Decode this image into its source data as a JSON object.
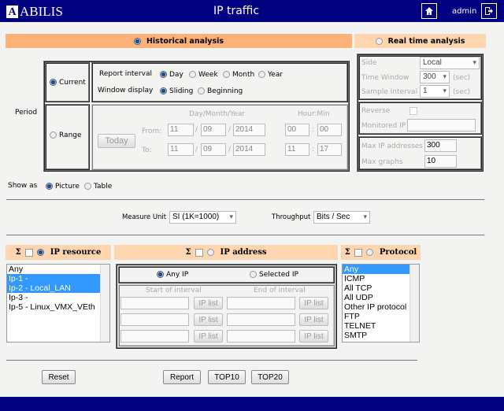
{
  "header": {
    "logo": "ABILIS",
    "title": "IP traffic",
    "user": "admin"
  },
  "tabs": {
    "historical": "Historical analysis",
    "realtime": "Real time analysis"
  },
  "period": {
    "label": "Period",
    "current": "Current",
    "range": "Range",
    "report_interval": "Report interval",
    "intervals": [
      "Day",
      "Week",
      "Month",
      "Year"
    ],
    "window_display": "Window display",
    "windows": [
      "Sliding",
      "Beginning"
    ],
    "dmy": "Day/Month/Year",
    "hm": "Hour:Min",
    "today": "Today",
    "from": "From:",
    "to": "To:",
    "from_vals": [
      "11",
      "09",
      "2014",
      "00",
      "00"
    ],
    "to_vals": [
      "11",
      "09",
      "2014",
      "11",
      "17"
    ],
    "sep_date": "/",
    "sep_time": ":"
  },
  "realtime": {
    "side_label": "Side",
    "side": "Local",
    "time_window_label": "Time Window",
    "time_window": "300",
    "sample_label": "Sample Interval",
    "sample": "1",
    "sec": "(sec)",
    "reverse": "Reverse",
    "monitored_ip": "Monitored IP",
    "max_ip_label": "Max IP addresses",
    "max_ip": "300",
    "max_graphs_label": "Max graphs",
    "max_graphs": "10"
  },
  "show_as": {
    "label": "Show as",
    "picture": "Picture",
    "table": "Table"
  },
  "measure": {
    "label": "Measure Unit",
    "value": "SI (1K=1000)",
    "throughput_label": "Throughput",
    "throughput": "Bits / Sec"
  },
  "sections": {
    "sigma": "Σ",
    "ip_resource": "IP resource",
    "ip_address": "IP address",
    "protocol": "Protocol"
  },
  "ip_resources": [
    "Any",
    "Ip-1 -",
    "Ip-2 - Local_LAN",
    "Ip-3 -",
    "Ip-5 - Linux_VMX_VEth"
  ],
  "ip_address": {
    "any": "Any IP",
    "selected": "Selected IP",
    "start": "Start of interval",
    "end": "End of interval",
    "ip_list": "IP list"
  },
  "protocols": [
    "Any",
    "ICMP",
    "All TCP",
    "All UDP",
    "Other IP protocol",
    "FTP",
    "TELNET",
    "SMTP"
  ],
  "buttons": {
    "reset": "Reset",
    "report": "Report",
    "top10": "TOP10",
    "top20": "TOP20"
  }
}
